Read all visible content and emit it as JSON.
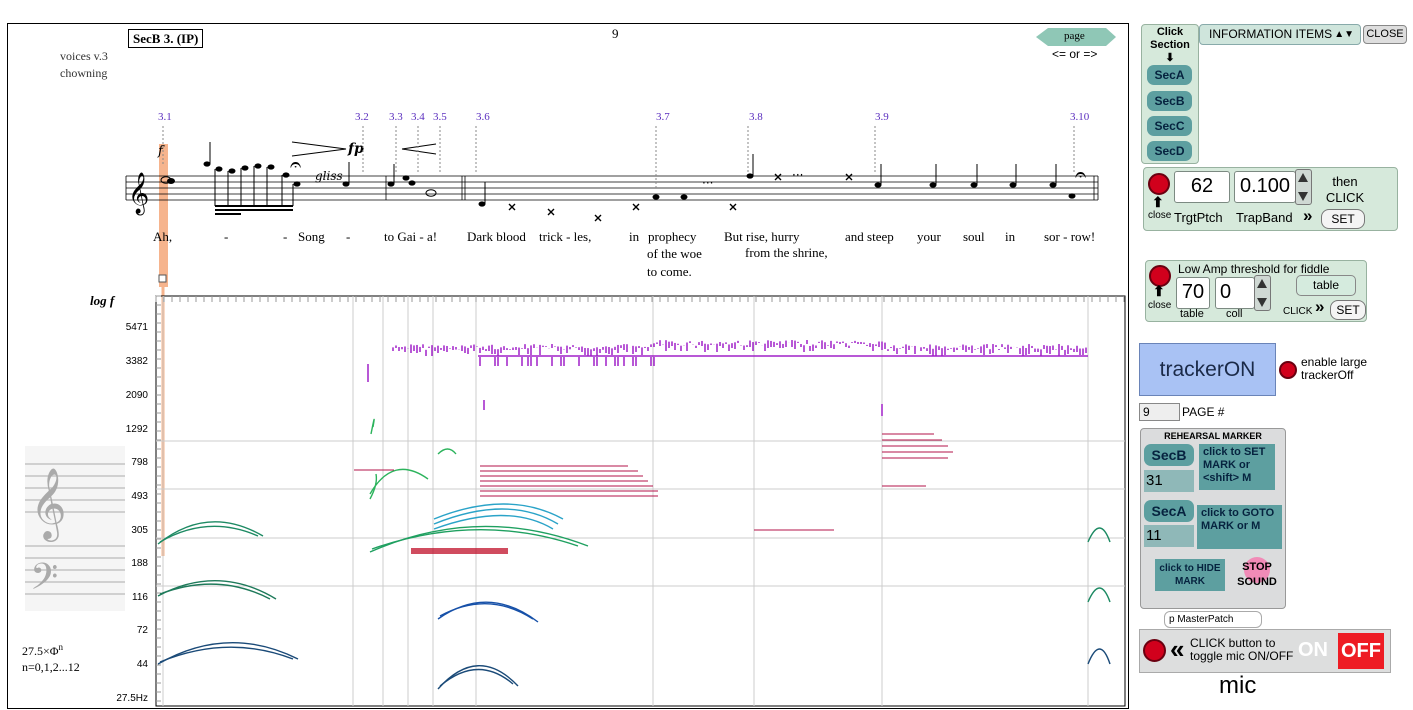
{
  "score": {
    "section_box": "SecB 3. (IP)",
    "page_number": "9",
    "nav": {
      "label": "page",
      "arrows": "<= or =>"
    },
    "credits": [
      "voices v.3",
      "chowning"
    ],
    "dynamics": [
      "fp",
      "f"
    ],
    "gliss": "gliss",
    "section_markers": [
      "3.1",
      "3.2",
      "3.3",
      "3.4",
      "3.5",
      "3.6",
      "3.7",
      "3.8",
      "3.9",
      "3.10"
    ],
    "lyrics": {
      "ah": "Ah,",
      "dash1": "-",
      "dash2": "-",
      "song": "Song",
      "dash3": "-",
      "to_gaia": "to Gai - a!",
      "dark_blood": "Dark blood",
      "trick": "trick - les,",
      "in1": "in",
      "prophecy": "prophecy",
      "of_the_woe": "of the woe",
      "to_come": "to come.",
      "but_rise": "But rise, hurry",
      "from_shrine": "from the shrine,",
      "and_steep": "and steep",
      "your": "your",
      "soul": "soul",
      "in2": "in",
      "sorrow": "sor - row!"
    },
    "spectrogram": {
      "axis_label": "log f",
      "y_ticks": [
        "5471",
        "3382",
        "2090",
        "1292",
        "798",
        "493",
        "305",
        "188",
        "116",
        "72",
        "44",
        "27.5Hz"
      ],
      "formula_line1": "27.5×Φ",
      "formula_sup": "n",
      "formula_line2": "n=0,1,2...12"
    }
  },
  "controls": {
    "click_section": {
      "line1": "Click",
      "line2": "Section",
      "arrow": "⬇"
    },
    "sections": [
      "SecA",
      "SecB",
      "SecC",
      "SecD"
    ],
    "info_menu": {
      "selected": "INFORMATION ITEMS",
      "close": "CLOSE"
    },
    "pitch_panel": {
      "target_pitch": "62",
      "trap_band": "0.100",
      "then_click": "then CLICK",
      "target_label": "TrgtPtch",
      "trap_label": "TrapBand",
      "set": "SET",
      "close": "close"
    },
    "low_amp_panel": {
      "title": "Low Amp threshold for fiddle",
      "table_value": "70",
      "coll_value": "0",
      "table_label": "table",
      "coll_label": "coll",
      "table_button": "table",
      "click_label": "CLICK",
      "set": "SET",
      "close": "close"
    },
    "tracker": {
      "button": "trackerON",
      "enable_label": "enable large trackerOff"
    },
    "page_field": {
      "value": "9",
      "label": "PAGE #"
    },
    "rehearsal": {
      "title": "REHEARSAL MARKER",
      "set_section": "SecB",
      "set_number": "31",
      "set_text": "click to SET MARK or <shift> M",
      "goto_section": "SecA",
      "goto_number": "11",
      "goto_text": "click to GOTO MARK or M",
      "hide_text": "click to HIDE MARK",
      "stop_text": "STOP SOUND"
    },
    "master_patch": "p MasterPatch",
    "mic": {
      "instruction": "CLICK button to toggle mic ON/OFF",
      "on": "ON",
      "off": "OFF",
      "label": "mic"
    }
  }
}
